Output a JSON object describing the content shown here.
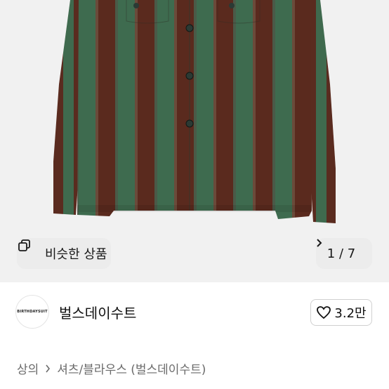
{
  "product_image": {
    "alt": ""
  },
  "similar_button": {
    "label": "비슷한 상품",
    "icon": "copy-icon"
  },
  "gallery": {
    "counter": "1 / 7",
    "icon": "chevron-right-icon"
  },
  "seller": {
    "avatar_text": "BIRTHDAYSUIT",
    "name": "벌스데이수트"
  },
  "like_button": {
    "count": "3.2만",
    "icon": "heart-icon"
  },
  "breadcrumb": {
    "category": "상의",
    "subcategory": "셔츠/블라우스 (벌스데이수트)"
  },
  "colors": {
    "stripe_green": "#3e6b4f",
    "stripe_brown": "#5a2a1e",
    "background": "#f1f1f1"
  }
}
